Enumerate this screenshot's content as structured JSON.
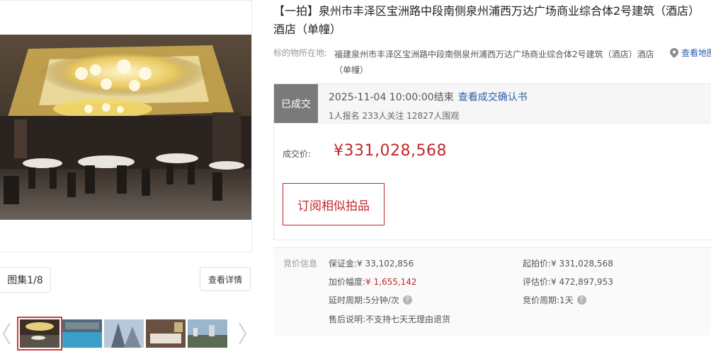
{
  "gallery": {
    "album_label": "图集1/8",
    "detail_label": "查看详情",
    "thumb_count": 5,
    "active_thumb": 0
  },
  "listing": {
    "title_line1": "【一拍】泉州市丰泽区宝洲路中段南侧泉州浦西万达广场商业综合体2号建筑（酒店）",
    "title_line2": "酒店（单幢）",
    "address_label": "标的物所在地:",
    "address_line1": "福建泉州市丰泽区宝洲路中段南侧泉州浦西万达广场商业综合体2号建筑（酒店）酒店",
    "address_line2": "（单幢）",
    "map_link": "查看地图",
    "map_icon": "location-pin-icon"
  },
  "deal": {
    "status": "已成交",
    "end_time": "2025-11-04 10:00:00结束",
    "confirm_link": "查看成交确认书",
    "stats": "1人报名  233人关注  12827人围观",
    "price_label": "成交价:",
    "price_value": "¥331,028,568",
    "subscribe_label": "订阅相似拍品"
  },
  "bid_info": {
    "heading": "竞价信息",
    "deposit_label": "保证金:",
    "deposit_value": "¥ 33,102,856",
    "increment_label": "加价幅度:",
    "increment_value": "¥ 1,655,142",
    "delay_label": "延时周期:",
    "delay_value": "5分钟/次",
    "aftersale_label": "售后说明:",
    "aftersale_value": "不支持七天无理由退货",
    "start_label": "起拍价:",
    "start_value": "¥ 331,028,568",
    "appraisal_label": "评估价:",
    "appraisal_value": "¥ 472,897,953",
    "cycle_label": "竞价周期:",
    "cycle_value": "1天"
  },
  "colors": {
    "accent_red": "#c2282d",
    "link_blue": "#2e5da8",
    "status_gray": "#7a7a7a"
  }
}
